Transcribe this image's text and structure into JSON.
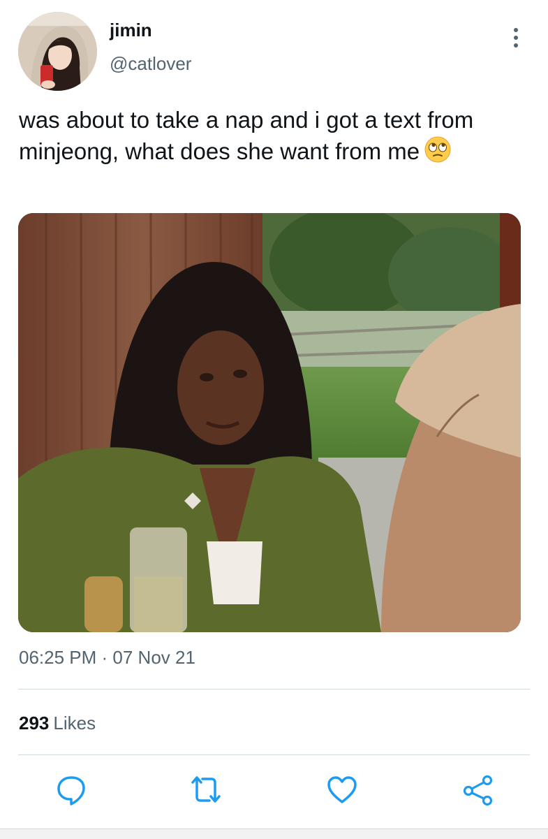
{
  "author": {
    "display_name": "jimin",
    "handle": "@catlover",
    "avatar_icon": "profile-photo"
  },
  "tweet": {
    "text": "was about to take a nap and i got a text from minjeong, what does she want from me",
    "emoji": "face-with-rolling-eyes",
    "media_description_icon": "photo"
  },
  "meta": {
    "timestamp": "06:25 PM · 07 Nov 21"
  },
  "stats": {
    "likes_count": "293",
    "likes_label": "Likes"
  },
  "actions": {
    "reply_icon": "reply-icon",
    "retweet_icon": "retweet-icon",
    "like_icon": "heart-icon",
    "share_icon": "share-icon"
  },
  "colors": {
    "primary_text": "#0f1419",
    "secondary_text": "#536471",
    "divider": "#cfd9de",
    "icon": "#1d9bf0"
  }
}
